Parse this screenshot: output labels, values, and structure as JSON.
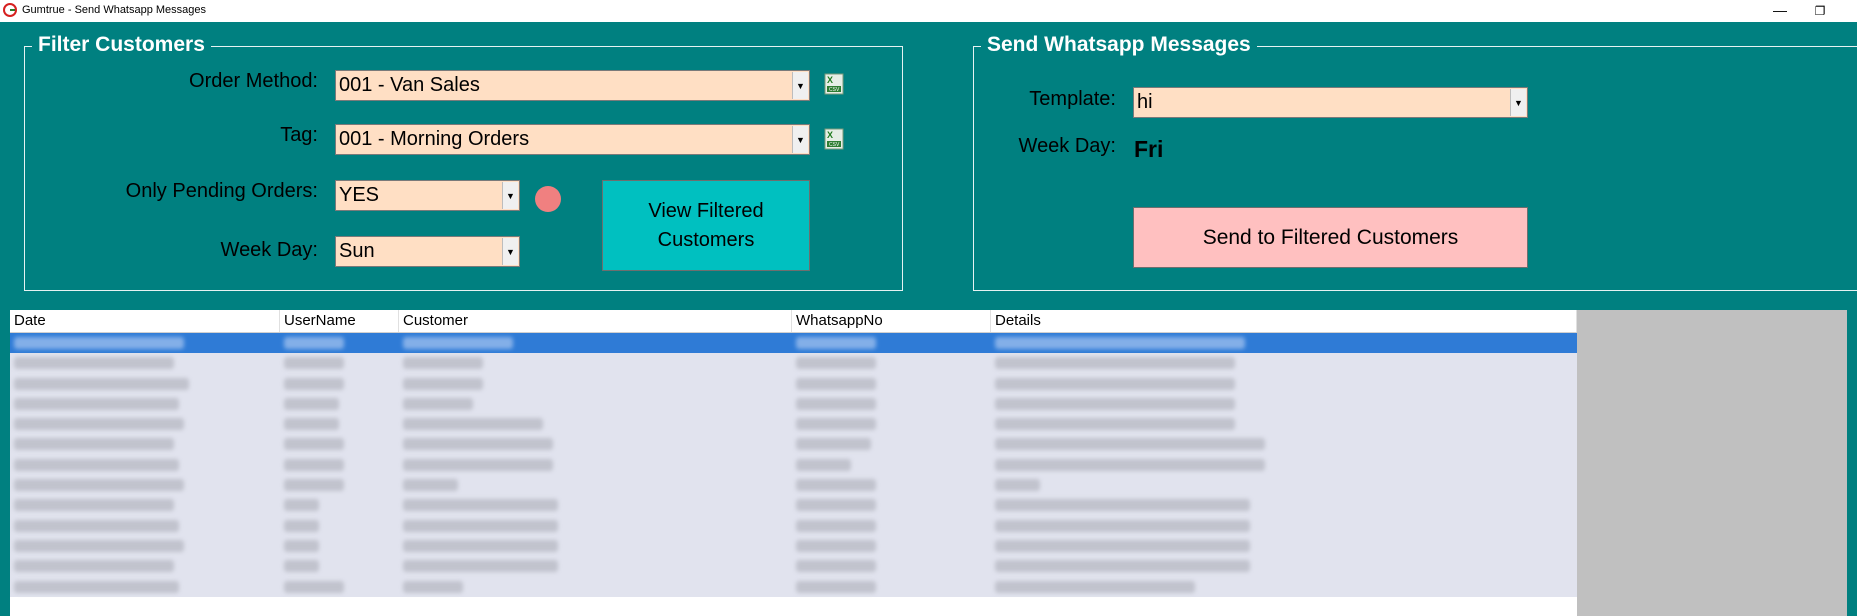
{
  "window": {
    "title": "Gumtrue - Send Whatsapp Messages",
    "minimize_glyph": "—",
    "maximize_glyph": "❐"
  },
  "filter": {
    "title": "Filter Customers",
    "order_method_label": "Order Method:",
    "order_method_value": "001 - Van Sales",
    "tag_label": "Tag:",
    "tag_value": "001 - Morning Orders",
    "pending_label": "Only Pending Orders:",
    "pending_value": "YES",
    "weekday_label": "Week Day:",
    "weekday_value": "Sun",
    "view_button_label": "View Filtered Customers"
  },
  "send": {
    "title": "Send Whatsapp Messages",
    "template_label": "Template:",
    "template_value": "hi",
    "weekday_label": "Week Day:",
    "weekday_value": "Fri",
    "send_button_label": "Send to Filtered Customers"
  },
  "grid": {
    "columns": [
      "Date",
      "UserName",
      "Customer",
      "WhatsappNo",
      "Details"
    ],
    "row_count_visible": 13,
    "selected_row": 0
  },
  "colors": {
    "background": "#008080",
    "combo_bg": "#ffdfc4",
    "view_button": "#00c0c0",
    "send_button": "#ffc0c0",
    "selection": "#2f7bd6"
  }
}
